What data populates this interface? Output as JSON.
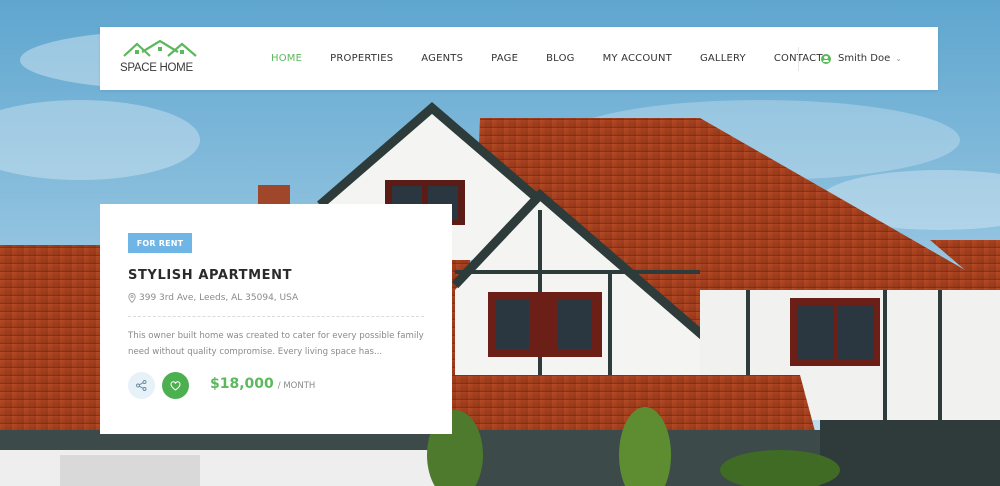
{
  "header": {
    "logo_text": "SPACE HOME",
    "nav": [
      {
        "label": "HOME",
        "active": true
      },
      {
        "label": "PROPERTIES",
        "active": false
      },
      {
        "label": "AGENTS",
        "active": false
      },
      {
        "label": "PAGE",
        "active": false
      },
      {
        "label": "BLOG",
        "active": false
      },
      {
        "label": "MY ACCOUNT",
        "active": false
      },
      {
        "label": "GALLERY",
        "active": false
      },
      {
        "label": "CONTACT",
        "active": false
      }
    ],
    "user": {
      "name": "Smith Doe",
      "icon": "user-icon",
      "dropdown_icon": "chevron-down-icon"
    }
  },
  "property": {
    "badge": "FOR RENT",
    "title": "STYLISH APARTMENT",
    "address": "399 3rd Ave, Leeds, AL 35094, USA",
    "description": "This owner built home was created to cater for every possible family need without quality compromise. Every living space has...",
    "price": "$18,000",
    "period": "/ MONTH",
    "share_icon": "share-icon",
    "favorite_icon": "heart-icon"
  },
  "colors": {
    "accent": "#5cb85c",
    "badge": "#6fb6e6",
    "text_dark": "#2b2b2b",
    "text_muted": "#8a8a8a"
  }
}
